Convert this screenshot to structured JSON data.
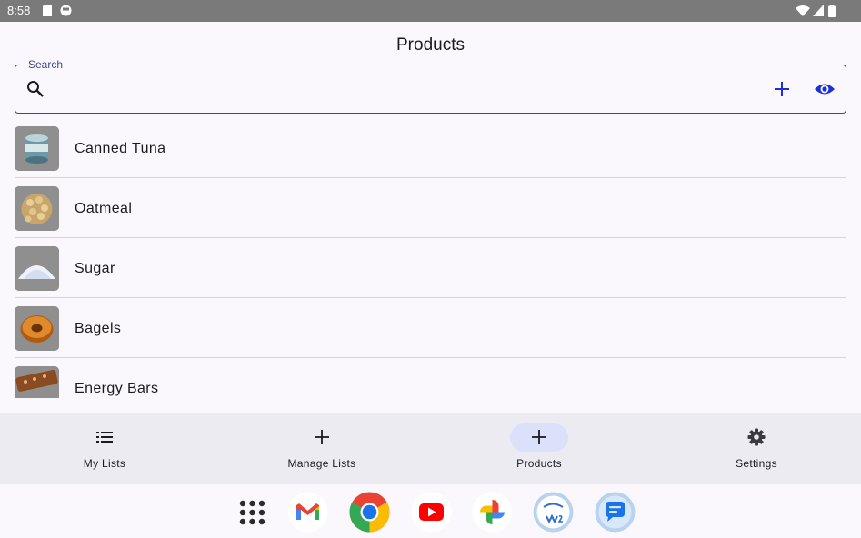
{
  "status_bar": {
    "time": "8:58",
    "icons": [
      "sd-card-icon",
      "circle-app-icon",
      "wifi-icon",
      "signal-icon",
      "battery-icon"
    ]
  },
  "header": {
    "title": "Products"
  },
  "search": {
    "label": "Search",
    "value": "",
    "placeholder": ""
  },
  "actions": {
    "add_icon": "plus-icon",
    "toggle_icon": "eye-icon",
    "accent": "#1c2fd8"
  },
  "products": [
    {
      "name": "Canned Tuna",
      "image": "canned-tuna-image"
    },
    {
      "name": "Oatmeal",
      "image": "oatmeal-image"
    },
    {
      "name": "Sugar",
      "image": "sugar-image"
    },
    {
      "name": "Bagels",
      "image": "bagel-image"
    },
    {
      "name": "Energy Bars",
      "image": "energy-bar-image"
    }
  ],
  "nav": {
    "active": "Products",
    "items": [
      {
        "label": "My Lists",
        "icon": "list-icon"
      },
      {
        "label": "Manage Lists",
        "icon": "plus-icon"
      },
      {
        "label": "Products",
        "icon": "plus-icon"
      },
      {
        "label": "Settings",
        "icon": "gear-icon"
      }
    ]
  },
  "dock": {
    "apps": [
      "app-drawer-icon",
      "gmail-icon",
      "chrome-icon",
      "youtube-icon",
      "photos-icon",
      "super-w2-icon",
      "messages-icon"
    ]
  }
}
